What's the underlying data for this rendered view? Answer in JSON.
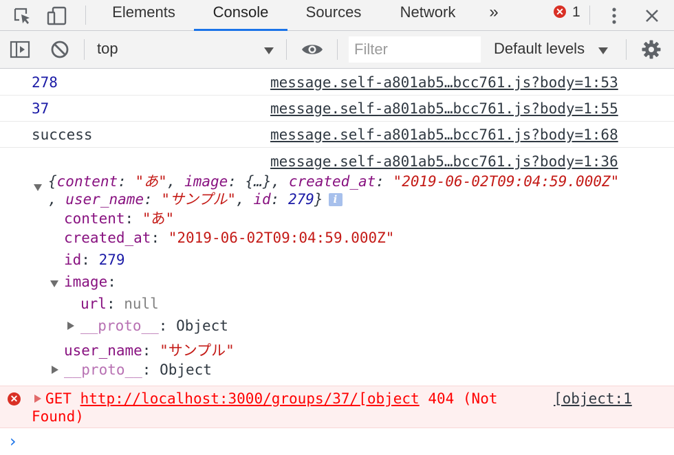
{
  "tabs": {
    "elements": "Elements",
    "console": "Console",
    "sources": "Sources",
    "network": "Network",
    "more": "»",
    "error_count": "1"
  },
  "toolbar": {
    "context": "top",
    "filter_placeholder": "Filter",
    "levels": "Default levels"
  },
  "messages": [
    {
      "text": "278",
      "source": "message.self-a801ab5…bcc761.js?body=1:53"
    },
    {
      "text": "37",
      "source": "message.self-a801ab5…bcc761.js?body=1:55"
    },
    {
      "text": "success",
      "source": "message.self-a801ab5…bcc761.js?body=1:68"
    },
    {
      "source": "message.self-a801ab5…bcc761.js?body=1:36"
    }
  ],
  "object": {
    "preview": {
      "open": "{",
      "k_content": "content",
      "v_content": "\"あ\"",
      "k_image": "image",
      "v_image": "{…}",
      "k_created": "created_at",
      "v_created": "\"2019-06-02T09:04:59.000Z\"",
      "k_user": "user_name",
      "v_user": "\"サンプル\"",
      "k_id": "id",
      "v_id": "279",
      "close": "}",
      "info": "i"
    },
    "props": {
      "content_key": "content",
      "content_val": "\"あ\"",
      "created_key": "created_at",
      "created_val": "\"2019-06-02T09:04:59.000Z\"",
      "id_key": "id",
      "id_val": "279",
      "image_key": "image",
      "url_key": "url",
      "url_val": "null",
      "proto_key": "__proto__",
      "proto_val": "Object",
      "user_key": "user_name",
      "user_val": "\"サンプル\"",
      "proto2_key": "__proto__",
      "proto2_val": "Object"
    }
  },
  "error": {
    "method": "GET",
    "url": "http://localhost:3000/groups/37/[object",
    "status": "404 (Not",
    "status_cont": "Found)",
    "source": "[object:1"
  },
  "prompt": "›"
}
